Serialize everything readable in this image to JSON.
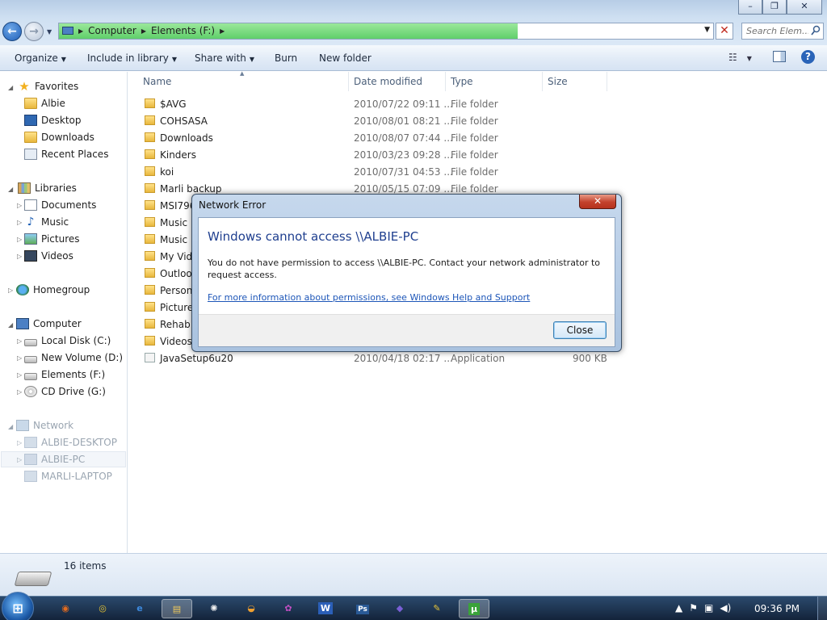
{
  "window": {
    "minimize": "–",
    "maximize": "❐",
    "close": "✕"
  },
  "nav": {
    "back": "←",
    "forward": "→",
    "recent": "▼"
  },
  "address": {
    "crumbs": [
      "Computer",
      "Elements (F:)"
    ],
    "stop": "✕",
    "dropdown": "▼"
  },
  "search": {
    "placeholder": "Search Elem..."
  },
  "toolbar": {
    "organize": "Organize",
    "include_in_library": "Include in library",
    "share_with": "Share with",
    "burn": "Burn",
    "new_folder": "New folder",
    "help": "?"
  },
  "sidebar": {
    "favorites": {
      "label": "Favorites",
      "items": [
        "Albie",
        "Desktop",
        "Downloads",
        "Recent Places"
      ]
    },
    "libraries": {
      "label": "Libraries",
      "items": [
        "Documents",
        "Music",
        "Pictures",
        "Videos"
      ]
    },
    "homegroup": "Homegroup",
    "computer": {
      "label": "Computer",
      "items": [
        "Local Disk (C:)",
        "New Volume (D:)",
        "Elements (F:)",
        "CD Drive (G:)"
      ]
    },
    "network": {
      "label": "Network",
      "items": [
        "ALBIE-DESKTOP",
        "ALBIE-PC",
        "MARLI-LAPTOP"
      ]
    }
  },
  "columns": {
    "name": "Name",
    "date_modified": "Date modified",
    "type": "Type",
    "size": "Size"
  },
  "files": [
    {
      "name": "$AVG",
      "date": "2010/07/22 09:11 ...",
      "type": "File folder",
      "size": ""
    },
    {
      "name": "COHSASA",
      "date": "2010/08/01 08:21 ...",
      "type": "File folder",
      "size": ""
    },
    {
      "name": "Downloads",
      "date": "2010/08/07 07:44 ...",
      "type": "File folder",
      "size": ""
    },
    {
      "name": "Kinders",
      "date": "2010/03/23 09:28 ...",
      "type": "File folder",
      "size": ""
    },
    {
      "name": "koi",
      "date": "2010/07/31 04:53 ...",
      "type": "File folder",
      "size": ""
    },
    {
      "name": "Marli backup",
      "date": "2010/05/15 07:09 ...",
      "type": "File folder",
      "size": ""
    },
    {
      "name": "MSI796",
      "date": "",
      "type": "",
      "size": ""
    },
    {
      "name": "Music",
      "date": "",
      "type": "",
      "size": ""
    },
    {
      "name": "Music L",
      "date": "",
      "type": "",
      "size": ""
    },
    {
      "name": "My Vid",
      "date": "",
      "type": "",
      "size": ""
    },
    {
      "name": "Outloo",
      "date": "",
      "type": "",
      "size": ""
    },
    {
      "name": "Persona",
      "date": "",
      "type": "",
      "size": ""
    },
    {
      "name": "Picture",
      "date": "",
      "type": "",
      "size": ""
    },
    {
      "name": "Rehab",
      "date": "",
      "type": "",
      "size": ""
    },
    {
      "name": "Videos",
      "date": "",
      "type": "",
      "size": ""
    },
    {
      "name": "JavaSetup6u20",
      "date": "2010/04/18 02:17 ...",
      "type": "Application",
      "size": "900 KB"
    }
  ],
  "status": {
    "item_count": "16 items"
  },
  "dialog": {
    "title": "Network Error",
    "close_x": "✕",
    "heading": "Windows cannot access \\\\ALBIE-PC",
    "message": "You do not have permission to access \\\\ALBIE-PC. Contact your network administrator to request access.",
    "link": "For more information about permissions, see Windows Help and Support",
    "close_button": "Close"
  },
  "taskbar": {
    "start": "⊞",
    "apps": [
      {
        "icon": "firefox-icon",
        "glyph": "◉",
        "color": "#e36b1f"
      },
      {
        "icon": "chrome-icon",
        "glyph": "◎",
        "color": "#e8c532"
      },
      {
        "icon": "ie-icon",
        "glyph": "e",
        "color": "#3d8be0"
      },
      {
        "icon": "explorer-icon",
        "glyph": "▤",
        "color": "#f0c95b"
      },
      {
        "icon": "app5-icon",
        "glyph": "✺",
        "color": "#f0f0f0"
      },
      {
        "icon": "app6-icon",
        "glyph": "◒",
        "color": "#f0a030"
      },
      {
        "icon": "picasa-icon",
        "glyph": "✿",
        "color": "#c44fc4"
      },
      {
        "icon": "word-icon",
        "glyph": "W",
        "color": "#2b5fb8"
      },
      {
        "icon": "photoshop-icon",
        "glyph": "Ps",
        "color": "#2a5a96"
      },
      {
        "icon": "app10-icon",
        "glyph": "◆",
        "color": "#7a5fd6"
      },
      {
        "icon": "paint-icon",
        "glyph": "✎",
        "color": "#e6c43a"
      },
      {
        "icon": "utorrent-icon",
        "glyph": "µ",
        "color": "#3aa33a"
      }
    ],
    "tray": [
      "▲",
      "⚑",
      "▣",
      "◀)"
    ],
    "clock": "09:36 PM"
  }
}
